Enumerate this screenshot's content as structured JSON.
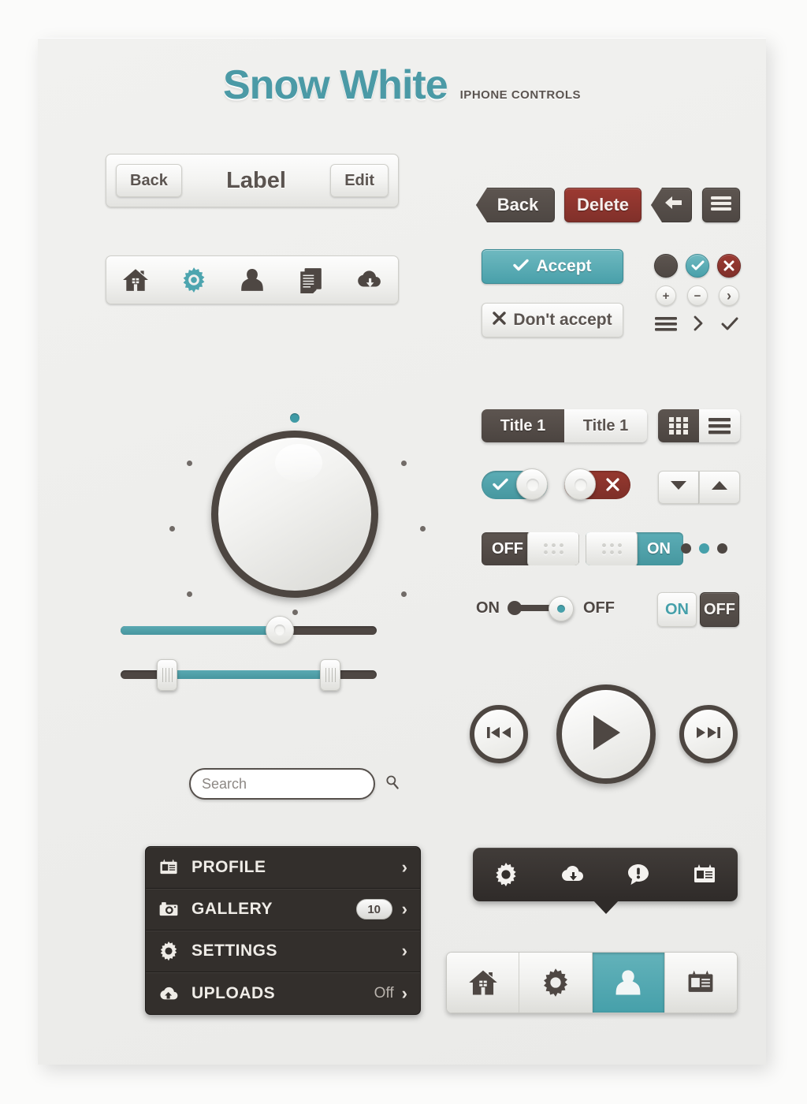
{
  "header": {
    "title": "Snow White",
    "subtitle": "IPHONE CONTROLS",
    "accent_color": "#4b9aa6",
    "dark_color": "#4e4743",
    "red_color": "#8c332c"
  },
  "navbar": {
    "back_label": "Back",
    "title": "Label",
    "edit_label": "Edit"
  },
  "iconbar": {
    "items": [
      {
        "icon": "home-icon",
        "active": false
      },
      {
        "icon": "gear-icon",
        "active": true
      },
      {
        "icon": "person-icon",
        "active": false
      },
      {
        "icon": "document-icon",
        "active": false
      },
      {
        "icon": "cloud-download-icon",
        "active": false
      }
    ]
  },
  "action_buttons": {
    "back_label": "Back",
    "delete_label": "Delete",
    "back_arrow_icon": "arrow-left-icon",
    "menu_icon": "hamburger-icon",
    "accept_label": "Accept",
    "accept_icon": "check-icon",
    "decline_label": "Don't accept",
    "decline_icon": "x-icon"
  },
  "circle_icons": {
    "row1": [
      {
        "icon": "filled-circle-icon",
        "style": "dark"
      },
      {
        "icon": "check-circle-icon",
        "style": "teal"
      },
      {
        "icon": "x-circle-icon",
        "style": "red"
      }
    ],
    "row2": [
      {
        "icon": "plus-icon",
        "label": "+"
      },
      {
        "icon": "minus-icon",
        "label": "−"
      },
      {
        "icon": "chevron-right-icon",
        "label": "›"
      }
    ],
    "row3": [
      {
        "icon": "hamburger-icon"
      },
      {
        "icon": "chevron-right-icon"
      },
      {
        "icon": "check-icon"
      }
    ]
  },
  "segmented": {
    "options": [
      {
        "label": "Title 1",
        "selected": true
      },
      {
        "label": "Title 1",
        "selected": false
      }
    ]
  },
  "view_toggle": {
    "options": [
      {
        "icon": "grid-view-icon",
        "selected": true
      },
      {
        "icon": "list-view-icon",
        "selected": false
      }
    ]
  },
  "toggles": [
    {
      "name": "check-toggle",
      "state": "on",
      "icon": "check-icon",
      "color": "#49a0aa"
    },
    {
      "name": "x-toggle",
      "state": "off",
      "icon": "x-icon",
      "color": "#8c332c"
    }
  ],
  "steppers": {
    "down_icon": "triangle-down-icon",
    "up_icon": "triangle-up-icon"
  },
  "onoff_switches": [
    {
      "name": "switch-off",
      "label": "OFF",
      "state": "off"
    },
    {
      "name": "switch-on",
      "label": "ON",
      "state": "on"
    }
  ],
  "page_dots": {
    "count": 3,
    "active_index": 1
  },
  "line_switch": {
    "left_label": "ON",
    "right_label": "OFF",
    "position": "off"
  },
  "onoff_buttons": [
    {
      "label": "ON",
      "style": "light",
      "selected": false
    },
    {
      "label": "OFF",
      "style": "dark",
      "selected": true
    }
  ],
  "knob": {
    "indicator_color": "#3f9aa5",
    "tick_count": 7
  },
  "sliders": [
    {
      "name": "volume-slider",
      "type": "single",
      "value": 62
    },
    {
      "name": "range-slider",
      "type": "range",
      "min_value": 18,
      "max_value": 82
    }
  ],
  "search": {
    "placeholder": "Search",
    "value": "",
    "icon": "search-icon"
  },
  "menu": {
    "items": [
      {
        "icon": "profile-card-icon",
        "label": "PROFILE",
        "badge": "",
        "value": "",
        "chevron": "›"
      },
      {
        "icon": "camera-icon",
        "label": "GALLERY",
        "badge": "10",
        "value": "",
        "chevron": "›"
      },
      {
        "icon": "gear-icon",
        "label": "SETTINGS",
        "badge": "",
        "value": "",
        "chevron": "›"
      },
      {
        "icon": "cloud-upload-icon",
        "label": "UPLOADS",
        "badge": "",
        "value": "Off",
        "chevron": "›"
      }
    ]
  },
  "player": {
    "previous_icon": "skip-back-icon",
    "play_icon": "play-icon",
    "next_icon": "skip-forward-icon"
  },
  "tooltip": {
    "items": [
      {
        "icon": "gear-icon"
      },
      {
        "icon": "cloud-download-icon"
      },
      {
        "icon": "alert-bubble-icon"
      },
      {
        "icon": "profile-card-icon"
      }
    ]
  },
  "tabbar": {
    "items": [
      {
        "icon": "home-icon",
        "active": false
      },
      {
        "icon": "gear-icon",
        "active": false
      },
      {
        "icon": "person-icon",
        "active": true
      },
      {
        "icon": "profile-card-icon",
        "active": false
      }
    ]
  }
}
